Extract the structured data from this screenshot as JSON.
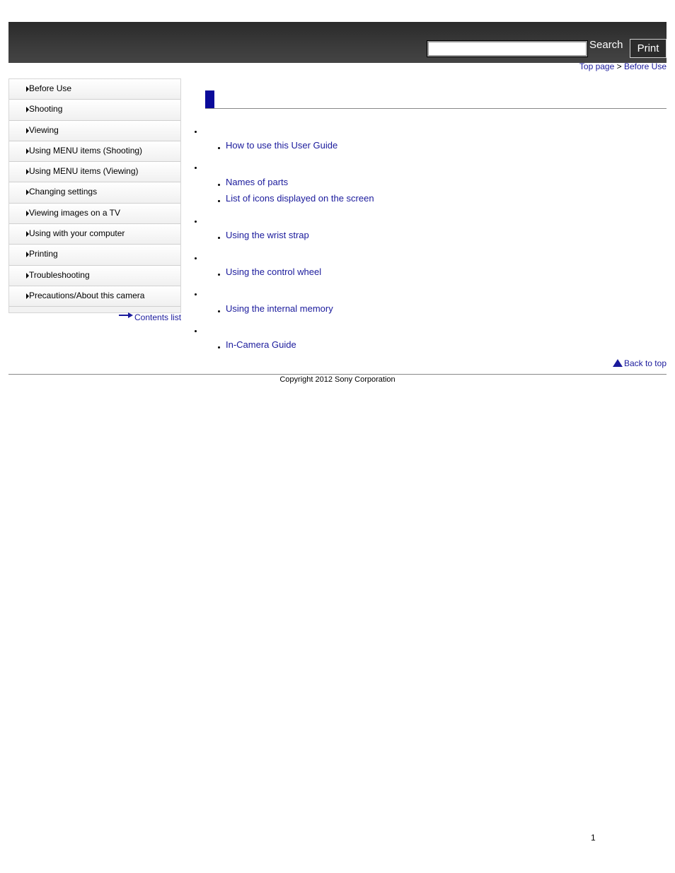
{
  "header": {
    "search_label": "Search",
    "search_value": "",
    "print_label": "Print"
  },
  "breadcrumb": {
    "top_page": "Top page",
    "separator": " > ",
    "current": "Before Use"
  },
  "sidebar": {
    "items": [
      {
        "label": "Before Use"
      },
      {
        "label": "Shooting"
      },
      {
        "label": "Viewing"
      },
      {
        "label": "Using MENU items (Shooting)"
      },
      {
        "label": "Using MENU items (Viewing)"
      },
      {
        "label": "Changing settings"
      },
      {
        "label": "Viewing images on a TV"
      },
      {
        "label": "Using with your computer"
      },
      {
        "label": "Printing"
      },
      {
        "label": "Troubleshooting"
      },
      {
        "label": "Precautions/About this camera"
      }
    ],
    "contents_list": "Contents list"
  },
  "main": {
    "links": [
      "How to use this User Guide",
      "Names of parts",
      "List of icons displayed on the screen",
      "Using the wrist strap",
      "Using the control wheel",
      "Using the internal memory",
      "In-Camera Guide"
    ],
    "back_to_top": "Back to top"
  },
  "footer": {
    "copyright": "Copyright 2012 Sony Corporation",
    "page_number": "1"
  },
  "colors": {
    "link": "#1a1a9c",
    "header_bg": "#3b3b3b",
    "title_accent": "#0a0a9a"
  }
}
